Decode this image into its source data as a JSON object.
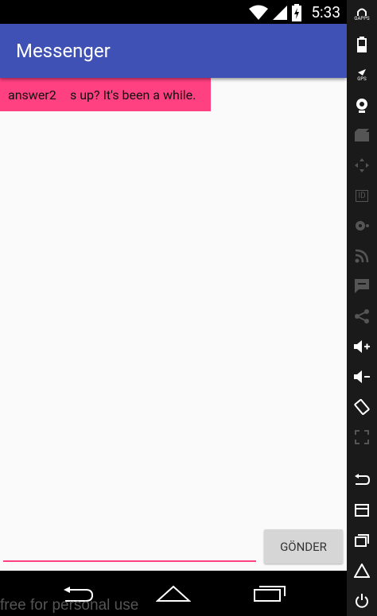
{
  "status": {
    "time": "5:33"
  },
  "app": {
    "title": "Messenger"
  },
  "message": {
    "part1": "answer2",
    "part2": "s up? It's been a while."
  },
  "composer": {
    "send_label": "GÖNDER"
  },
  "watermark": "free for personal use",
  "sidebar": {
    "gapps": "GAPPS",
    "gps": "GPS",
    "id": "ID"
  }
}
